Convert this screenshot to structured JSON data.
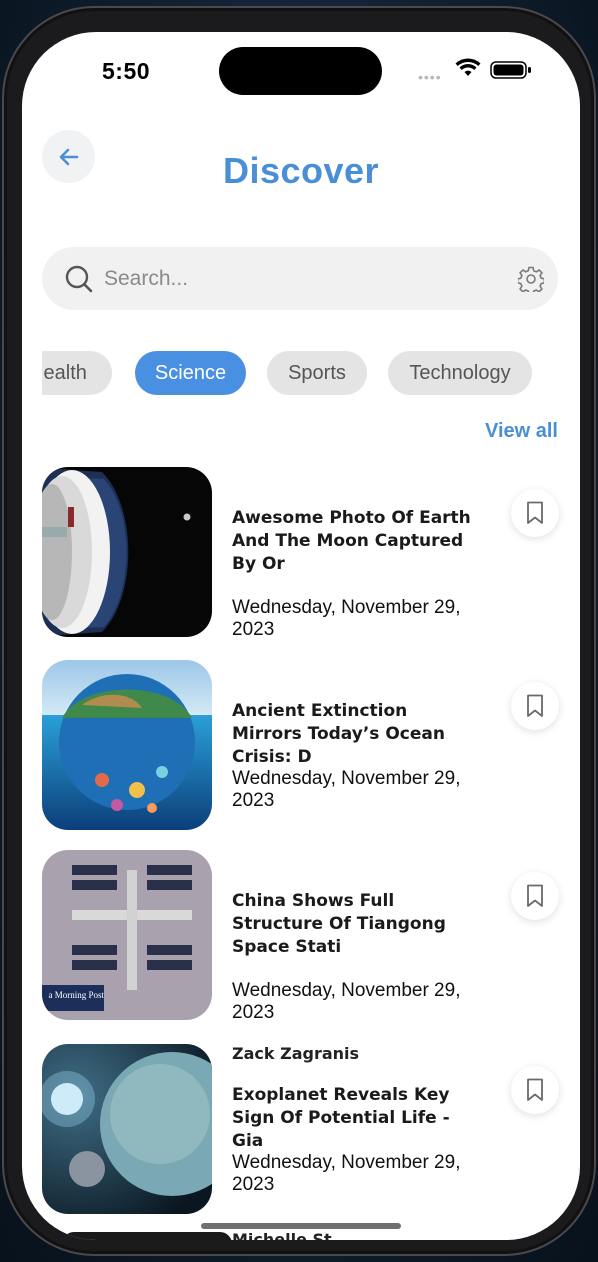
{
  "status_bar": {
    "time": "5:50"
  },
  "header": {
    "title": "Discover",
    "back_icon": "arrow-left-icon"
  },
  "search": {
    "placeholder": "Search...",
    "value": "",
    "filter_icon": "gear-icon"
  },
  "categories": [
    {
      "label": "Health",
      "active": false
    },
    {
      "label": "Science",
      "active": true
    },
    {
      "label": "Sports",
      "active": false
    },
    {
      "label": "Technology",
      "active": false
    }
  ],
  "view_all_label": "View all",
  "articles": [
    {
      "author": "",
      "title": "Awesome Photo Of Earth And The Moon Captured By Or",
      "date": "Wednesday, November 29, 2023",
      "image": "spacecraft-and-moon"
    },
    {
      "author": "",
      "title": "Ancient Extinction Mirrors Today’s Ocean Crisis: D",
      "date": "Wednesday, November 29, 2023",
      "image": "earth-ocean-sphere"
    },
    {
      "author": "",
      "title": "China Shows Full Structure Of Tiangong Space Stati",
      "date": "Wednesday, November 29, 2023",
      "image": "space-station-aerial",
      "image_caption": "a Morning Post"
    },
    {
      "author": "Zack Zagranis",
      "title": "Exoplanet Reveals Key Sign Of Potential Life - Gia",
      "date": "Wednesday, November 29, 2023",
      "image": "exoplanet"
    }
  ],
  "partial_next_author": "Michelle St",
  "colors": {
    "accent": "#4a8fd6",
    "chip_active": "#4a90e2",
    "chip_inactive": "#e4e4e4"
  }
}
